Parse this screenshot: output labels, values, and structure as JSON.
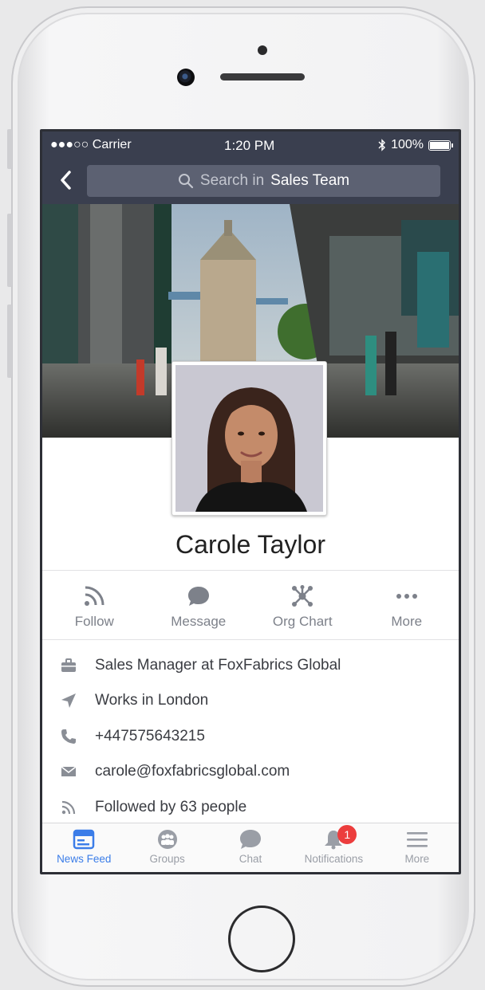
{
  "status_bar": {
    "carrier": "●●●○○ Carrier",
    "time": "1:20 PM",
    "battery": "100%"
  },
  "header": {
    "search_prefix": "Search in",
    "search_scope": "Sales Team"
  },
  "profile": {
    "name": "Carole Taylor"
  },
  "actions": [
    {
      "label": "Follow",
      "icon": "rss-icon"
    },
    {
      "label": "Message",
      "icon": "chat-bubble-icon"
    },
    {
      "label": "Org Chart",
      "icon": "org-chart-icon"
    },
    {
      "label": "More",
      "icon": "ellipsis-icon"
    }
  ],
  "details": [
    {
      "icon": "briefcase-icon",
      "text": "Sales Manager at FoxFabrics Global"
    },
    {
      "icon": "location-arrow-icon",
      "text": "Works in London"
    },
    {
      "icon": "phone-icon",
      "text": "+447575643215"
    },
    {
      "icon": "envelope-icon",
      "text": "carole@foxfabricsglobal.com"
    },
    {
      "icon": "rss-icon",
      "text": "Followed by 63 people"
    }
  ],
  "tabbar": [
    {
      "label": "News Feed",
      "icon": "news-feed-icon",
      "active": true
    },
    {
      "label": "Groups",
      "icon": "groups-icon",
      "active": false
    },
    {
      "label": "Chat",
      "icon": "chat-icon",
      "active": false
    },
    {
      "label": "Notifications",
      "icon": "bell-icon",
      "active": false,
      "badge": "1"
    },
    {
      "label": "More",
      "icon": "hamburger-icon",
      "active": false
    }
  ],
  "colors": {
    "header_bg": "#3a3f4f",
    "accent": "#3b7de8",
    "badge": "#ec3d3d"
  }
}
